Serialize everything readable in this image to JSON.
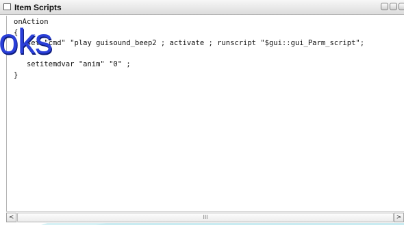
{
  "window": {
    "title": "Item Scripts"
  },
  "editor": {
    "lines": [
      "onAction",
      "{",
      "   set \"cmd\" \"play guisound_beep2 ; activate ; runscript \"$gui::gui_Parm_script\";",
      "",
      "   setitemdvar \"anim\" \"0\" ;",
      "}"
    ]
  },
  "watermark": {
    "text": "oks"
  },
  "scrollbar": {
    "left_arrow": "<",
    "right_arrow": ">",
    "thumb_grip": "III"
  },
  "colors": {
    "watermark": "#2a3fd8",
    "wave": "#cfeef3"
  }
}
